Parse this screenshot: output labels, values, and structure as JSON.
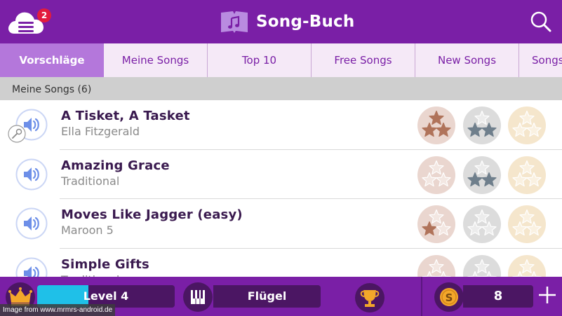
{
  "header": {
    "title": "Song-Buch",
    "notification_count": "2",
    "menu_icon": "cloud-menu-icon",
    "search_icon": "search-icon",
    "brand_color": "#7a1fa6"
  },
  "tabs": [
    {
      "label": "Vorschläge",
      "active": true
    },
    {
      "label": "Meine Songs",
      "active": false
    },
    {
      "label": "Top 10",
      "active": false
    },
    {
      "label": "Free Songs",
      "active": false
    },
    {
      "label": "New Songs",
      "active": false
    },
    {
      "label": "Songs",
      "active": false
    }
  ],
  "section": {
    "title": "Meine Songs (6)"
  },
  "songs": [
    {
      "title": "A Tisket, A Tasket",
      "artist": "Ella Fitzgerald",
      "has_mic": true,
      "stars": {
        "bronze": 3,
        "silver": 2,
        "gold": 0
      }
    },
    {
      "title": "Amazing Grace",
      "artist": "Traditional",
      "has_mic": false,
      "stars": {
        "bronze": 0,
        "silver": 2,
        "gold": 0
      }
    },
    {
      "title": "Moves Like Jagger (easy)",
      "artist": "Maroon 5",
      "has_mic": false,
      "stars": {
        "bronze": 1,
        "silver": 0,
        "gold": 0
      }
    },
    {
      "title": "Simple Gifts",
      "artist": "Traditional",
      "has_mic": false,
      "stars": {
        "bronze": 0,
        "silver": 0,
        "gold": 0
      }
    }
  ],
  "bottom_bar": {
    "level_label": "Level 4",
    "level_progress": 0.37,
    "instrument": "Flügel",
    "coins": "8"
  },
  "watermark": "Image from www.mrmrs-android.de"
}
